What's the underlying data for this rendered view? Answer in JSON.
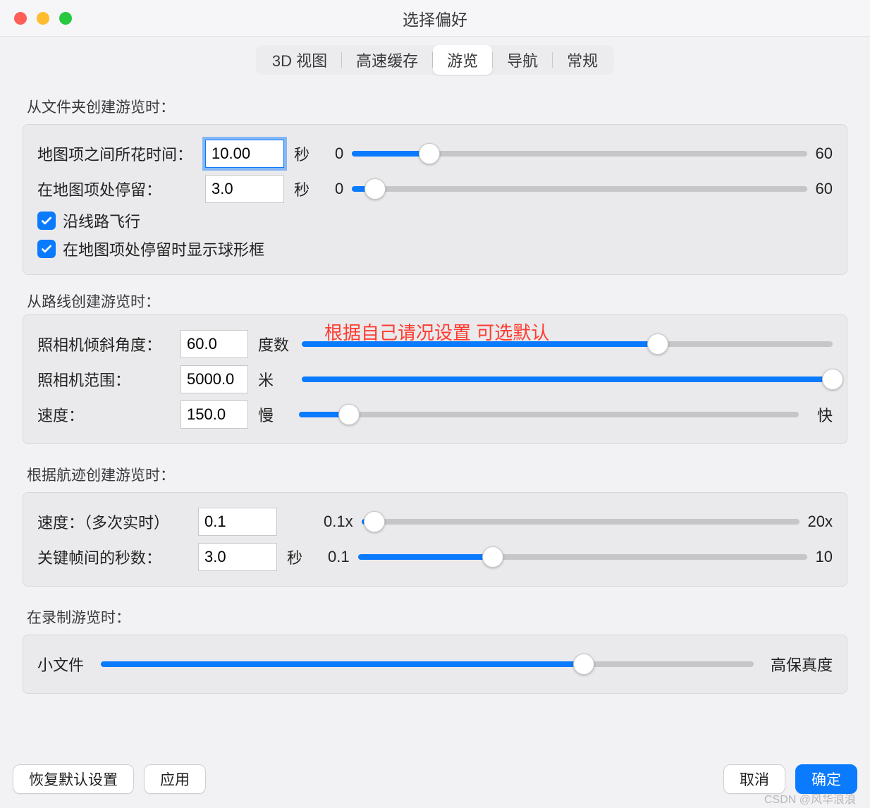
{
  "window": {
    "title": "选择偏好"
  },
  "tabs": {
    "items": [
      "3D 视图",
      "高速缓存",
      "游览",
      "导航",
      "常规"
    ],
    "active_index": 2
  },
  "annotation": "根据自己请况设置 可选默认",
  "section_folder": {
    "title": "从文件夹创建游览时：",
    "time_between": {
      "label": "地图项之间所花时间：",
      "value": "10.00",
      "unit": "秒",
      "min": "0",
      "max": "60",
      "slider_pct": 17
    },
    "wait_at": {
      "label": "在地图项处停留：",
      "value": "3.0",
      "unit": "秒",
      "min": "0",
      "max": "60",
      "slider_pct": 5
    },
    "fly_along": {
      "label": "沿线路飞行",
      "checked": true
    },
    "show_balloon": {
      "label": "在地图项处停留时显示球形框",
      "checked": true
    }
  },
  "section_route": {
    "title": "从路线创建游览时：",
    "tilt": {
      "label": "照相机倾斜角度：",
      "value": "60.0",
      "unit": "度数",
      "slider_pct": 67
    },
    "range": {
      "label": "照相机范围：",
      "value": "5000.0",
      "unit": "米",
      "slider_pct": 100
    },
    "speed": {
      "label": "速度：",
      "value": "150.0",
      "left": "慢",
      "right": "快",
      "slider_pct": 10
    }
  },
  "section_track": {
    "title": "根据航迹创建游览时：",
    "speed": {
      "label": "速度：（多次实时）",
      "value": "0.1",
      "min": "0.1x",
      "max": "20x",
      "slider_pct": 3
    },
    "keyframe": {
      "label": "关键帧间的秒数：",
      "value": "3.0",
      "unit": "秒",
      "min": "0.1",
      "max": "10",
      "slider_pct": 30
    }
  },
  "section_record": {
    "title": "在录制游览时：",
    "quality": {
      "left": "小文件",
      "right": "高保真度",
      "slider_pct": 74
    }
  },
  "buttons": {
    "restore": "恢复默认设置",
    "apply": "应用",
    "cancel": "取消",
    "ok": "确定"
  },
  "watermark": "CSDN @风华浪浪"
}
